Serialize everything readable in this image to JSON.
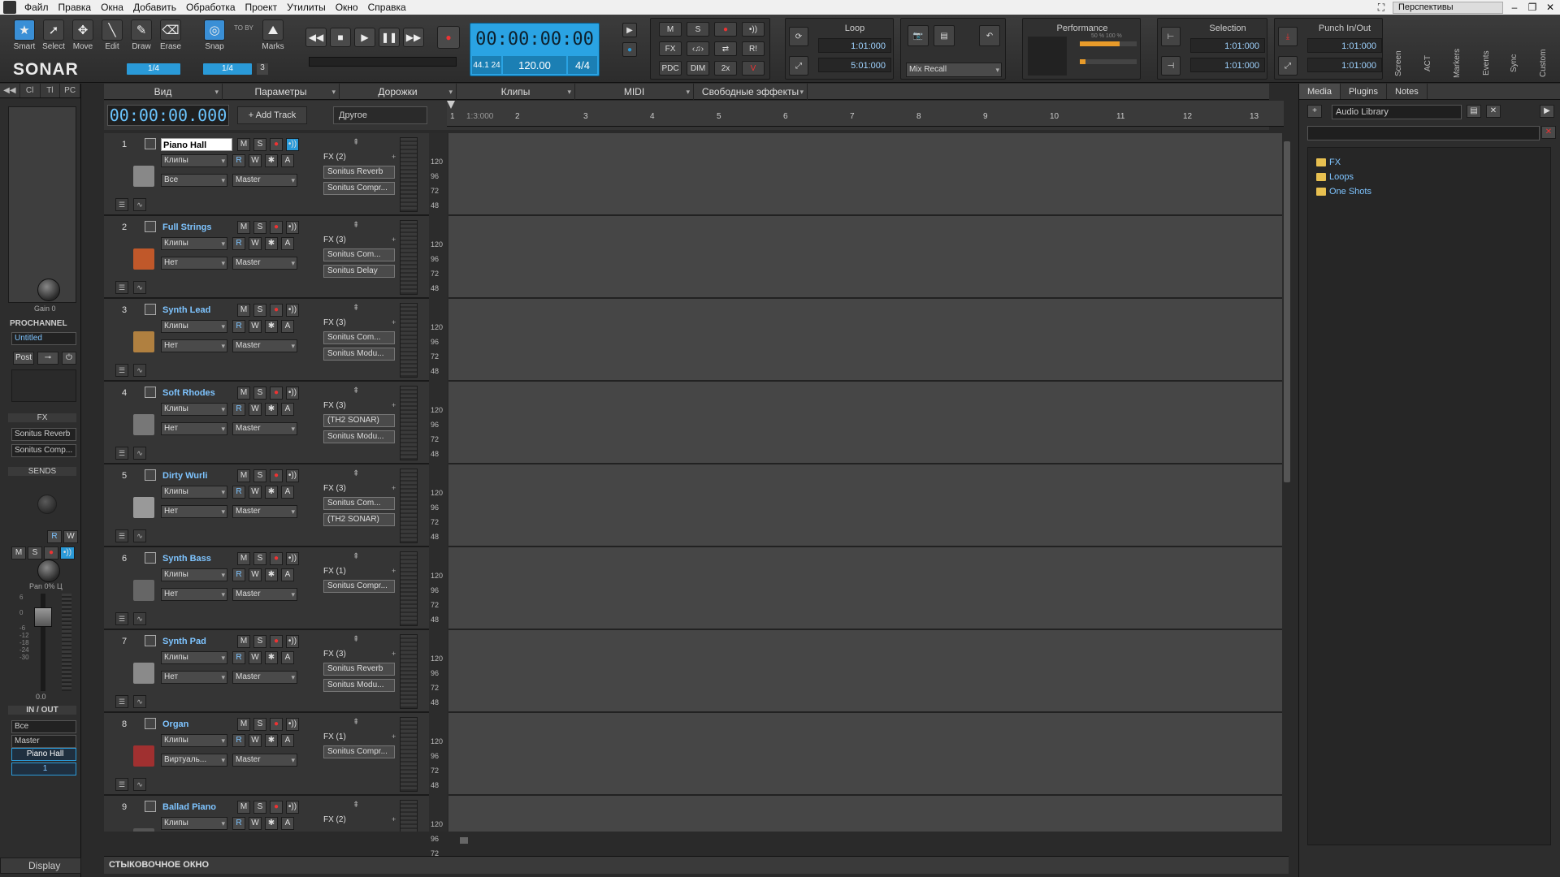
{
  "menubar": {
    "items": [
      "Файл",
      "Правка",
      "Окна",
      "Добавить",
      "Обработка",
      "Проект",
      "Утилиты",
      "Окно",
      "Справка"
    ],
    "perspectives": "Перспективы"
  },
  "tools": [
    {
      "label": "Smart",
      "icon": "smart-tool-icon",
      "glyph": "★"
    },
    {
      "label": "Select",
      "icon": "select-tool-icon",
      "glyph": "➚"
    },
    {
      "label": "Move",
      "icon": "move-tool-icon",
      "glyph": "✥"
    },
    {
      "label": "Edit",
      "icon": "edit-tool-icon",
      "glyph": "╲"
    },
    {
      "label": "Draw",
      "icon": "draw-tool-icon",
      "glyph": "✎"
    },
    {
      "label": "Erase",
      "icon": "erase-tool-icon",
      "glyph": "⌫"
    }
  ],
  "logo": "SONAR",
  "snap": {
    "label": "Snap",
    "value": "1/4",
    "to_by": "TO BY",
    "marks": "Marks",
    "snap_value": "1/4",
    "count": "3"
  },
  "transport": {
    "time": "00:00:00:00",
    "sample_rate": "44.1",
    "bit_depth": "24",
    "tempo": "120.00",
    "meter": "4/4"
  },
  "mix_buttons": [
    "M",
    "S",
    "●",
    "•))",
    "FX",
    "‹♫›",
    "⇄",
    "R!",
    "PDC",
    "DIM",
    "2x",
    "V"
  ],
  "loop": {
    "title": "Loop",
    "start": "1:01:000",
    "end": "5:01:000"
  },
  "mix_recall": "Mix Recall",
  "performance": {
    "title": "Performance",
    "p1": "50 %",
    "p2": "100 %"
  },
  "selection": {
    "title": "Selection",
    "start": "1:01:000",
    "end": "1:01:000"
  },
  "punch": {
    "title": "Punch In/Out",
    "start": "1:01:000",
    "end": "1:01:000"
  },
  "vert_tabs": [
    "Screen",
    "ACT",
    "Markers",
    "Events",
    "Sync",
    "Custom"
  ],
  "inspector": {
    "tabs": [
      "Cl",
      "Tl",
      "PC"
    ],
    "gain_label": "Gain",
    "gain_value": "0",
    "prochannel_title": "PROCHANNEL",
    "preset": "Untitled",
    "post": "Post",
    "fx_title": "FX",
    "fx_items": [
      "Sonitus Reverb",
      "Sonitus Comp..."
    ],
    "sends_title": "SENDS",
    "pan_label": "Pan",
    "pan_value": "0% Ц",
    "level_value": "0.0",
    "fader_scale": [
      "6",
      "0",
      "-6",
      "-12",
      "-18",
      "-24",
      "-30"
    ],
    "inout_title": "IN / OUT",
    "input": "Все",
    "output": "Master",
    "track_name": "Piano Hall",
    "track_number": "1",
    "display": "Display"
  },
  "trackview": {
    "menus": [
      "Вид",
      "Параметры",
      "Дорожки",
      "Клипы",
      "MIDI",
      "Свободные эффекты"
    ],
    "time": "00:00:00.000",
    "add_track": "Add Track",
    "other": "Другое",
    "vel_scale": [
      "120",
      "96",
      "72",
      "48"
    ]
  },
  "timeline": {
    "ticks": [
      "1",
      "1:3:000",
      "2",
      "3",
      "4",
      "5",
      "6",
      "7",
      "8",
      "9",
      "10",
      "11",
      "12",
      "13"
    ]
  },
  "tracks": [
    {
      "num": "1",
      "name": "Piano Hall",
      "clips": "Клипы",
      "input": "Все",
      "output": "Master",
      "fx_head": "FX (2)",
      "fx": [
        "Sonitus Reverb",
        "Sonitus Compr..."
      ],
      "img_color": "#888"
    },
    {
      "num": "2",
      "name": "Full Strings",
      "clips": "Клипы",
      "input": "Нет",
      "output": "Master",
      "fx_head": "FX (3)",
      "fx": [
        "Sonitus Com...",
        "Sonitus Delay"
      ],
      "img_color": "#c0582a"
    },
    {
      "num": "3",
      "name": "Synth Lead",
      "clips": "Клипы",
      "input": "Нет",
      "output": "Master",
      "fx_head": "FX (3)",
      "fx": [
        "Sonitus Com...",
        "Sonitus Modu..."
      ],
      "img_color": "#b08040"
    },
    {
      "num": "4",
      "name": "Soft Rhodes",
      "clips": "Клипы",
      "input": "Нет",
      "output": "Master",
      "fx_head": "FX (3)",
      "fx": [
        "(TH2 SONAR)",
        "Sonitus Modu..."
      ],
      "img_color": "#777"
    },
    {
      "num": "5",
      "name": "Dirty Wurli",
      "clips": "Клипы",
      "input": "Нет",
      "output": "Master",
      "fx_head": "FX (3)",
      "fx": [
        "Sonitus Com...",
        "(TH2 SONAR)"
      ],
      "img_color": "#999"
    },
    {
      "num": "6",
      "name": "Synth Bass",
      "clips": "Клипы",
      "input": "Нет",
      "output": "Master",
      "fx_head": "FX (1)",
      "fx": [
        "Sonitus Compr..."
      ],
      "img_color": "#666"
    },
    {
      "num": "7",
      "name": "Synth Pad",
      "clips": "Клипы",
      "input": "Нет",
      "output": "Master",
      "fx_head": "FX (3)",
      "fx": [
        "Sonitus Reverb",
        "Sonitus Modu..."
      ],
      "img_color": "#8a8a8a"
    },
    {
      "num": "8",
      "name": "Organ",
      "clips": "Клипы",
      "input": "Виртуаль...",
      "output": "Master",
      "fx_head": "FX (1)",
      "fx": [
        "Sonitus Compr..."
      ],
      "img_color": "#a03030"
    },
    {
      "num": "9",
      "name": "Ballad Piano",
      "clips": "Клипы",
      "input": "Нет",
      "output": "Master",
      "fx_head": "FX (2)",
      "fx": [],
      "img_color": "#555"
    }
  ],
  "track_buttons": {
    "mute": "M",
    "solo": "S",
    "rec": "●",
    "echo": "•))",
    "read": "R",
    "write": "W",
    "freeze": "✱",
    "auto": "A"
  },
  "browser": {
    "tabs": [
      "Media",
      "Plugins",
      "Notes"
    ],
    "library": "Audio Library",
    "items": [
      "FX",
      "Loops",
      "One Shots"
    ]
  },
  "dock_title": "СТЫКОВОЧНОЕ ОКНО",
  "colors": {
    "accent": "#2a9ad8",
    "clip_bg": "#464646",
    "track_name": "#7ec4ff"
  }
}
